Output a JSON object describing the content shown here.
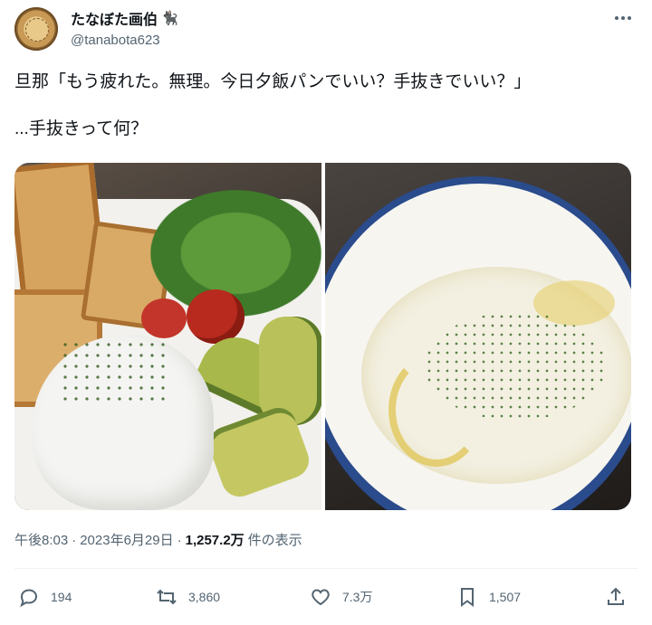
{
  "author": {
    "display_name": "たなぼた画伯",
    "emoji": "🐈‍⬛",
    "handle": "@tanabota623"
  },
  "tweet": {
    "text": "旦那「もう疲れた。無理。今日夕飯パンでいい？手抜きでいい？」\n\n...手抜きって何？"
  },
  "meta": {
    "time": "午後8:03",
    "sep1": "·",
    "date": "2023年6月29日",
    "sep2": "·",
    "views": "1,257.2万",
    "views_label": "件の表示"
  },
  "actions": {
    "reply_count": "194",
    "retweet_count": "3,860",
    "like_count": "7.3万",
    "bookmark_count": "1,507"
  },
  "icons": {
    "reply": "reply-icon",
    "retweet": "retweet-icon",
    "like": "heart-icon",
    "bookmark": "bookmark-icon",
    "share": "share-icon",
    "more": "more-icon"
  },
  "colors": {
    "text": "#0f1419",
    "secondary": "#536471",
    "divider": "#eff3f4"
  }
}
